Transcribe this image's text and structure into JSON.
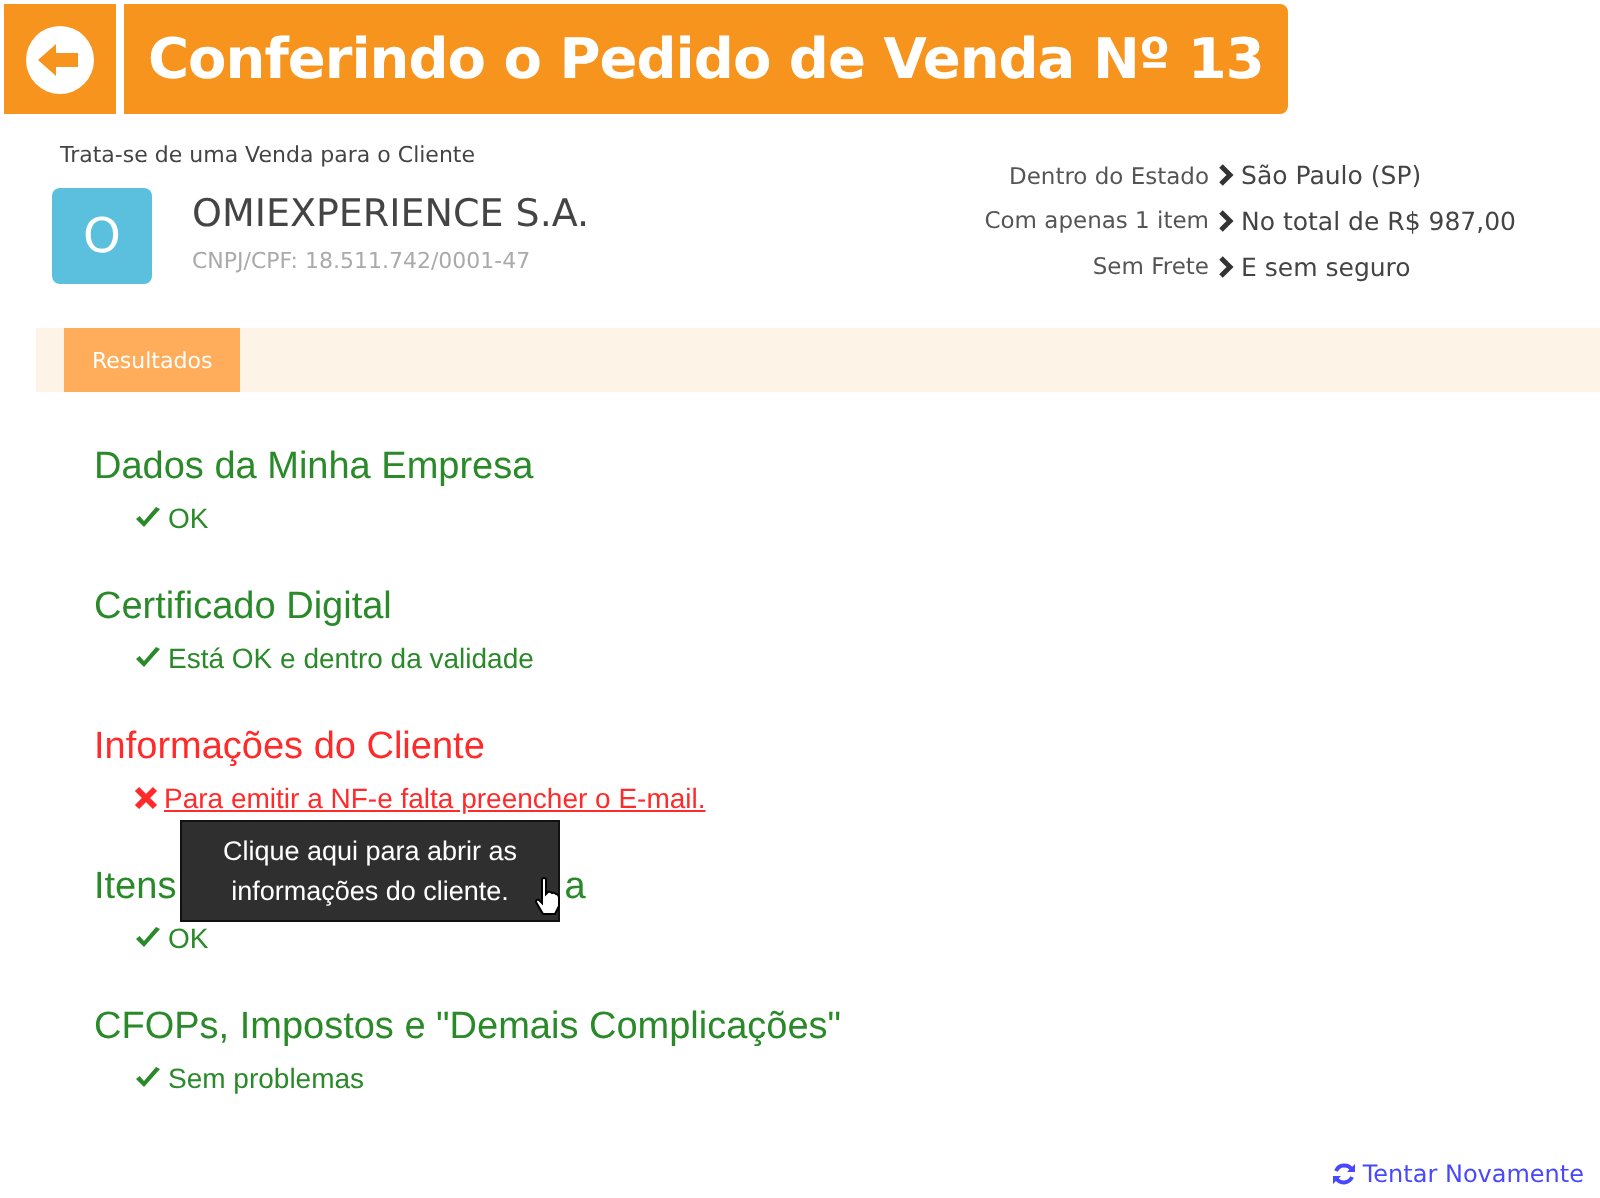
{
  "header": {
    "title": "Conferindo o Pedido de Venda Nº 13"
  },
  "client": {
    "intro": "Trata-se de uma Venda para o Cliente",
    "initial": "O",
    "name": "OMIEXPERIENCE S.A.",
    "document": "CNPJ/CPF: 18.511.742/0001-47"
  },
  "summary": [
    {
      "label": "Dentro do Estado",
      "value": "São Paulo (SP)"
    },
    {
      "label": "Com apenas 1 item",
      "value": "No total de R$ 987,00"
    },
    {
      "label": "Sem Frete",
      "value": "E sem seguro"
    }
  ],
  "tabs": [
    {
      "label": "Resultados",
      "selected": true
    }
  ],
  "sections": [
    {
      "title": "Dados da Minha Empresa",
      "kind": "ok",
      "message": "OK"
    },
    {
      "title": "Certificado Digital",
      "kind": "ok",
      "message": "Está OK e dentro da validade"
    },
    {
      "title": "Informações do Cliente",
      "kind": "error",
      "message": "Para emitir a NF-e falta preencher o E-mail."
    },
    {
      "title": "Itens",
      "title_end": "a",
      "kind": "ok",
      "message": "OK",
      "tooltip": "Clique aqui para abrir as informações do cliente."
    },
    {
      "title": "CFOPs, Impostos e \"Demais Complicações\"",
      "kind": "ok",
      "message": "Sem problemas"
    }
  ],
  "retry": "Tentar Novamente"
}
